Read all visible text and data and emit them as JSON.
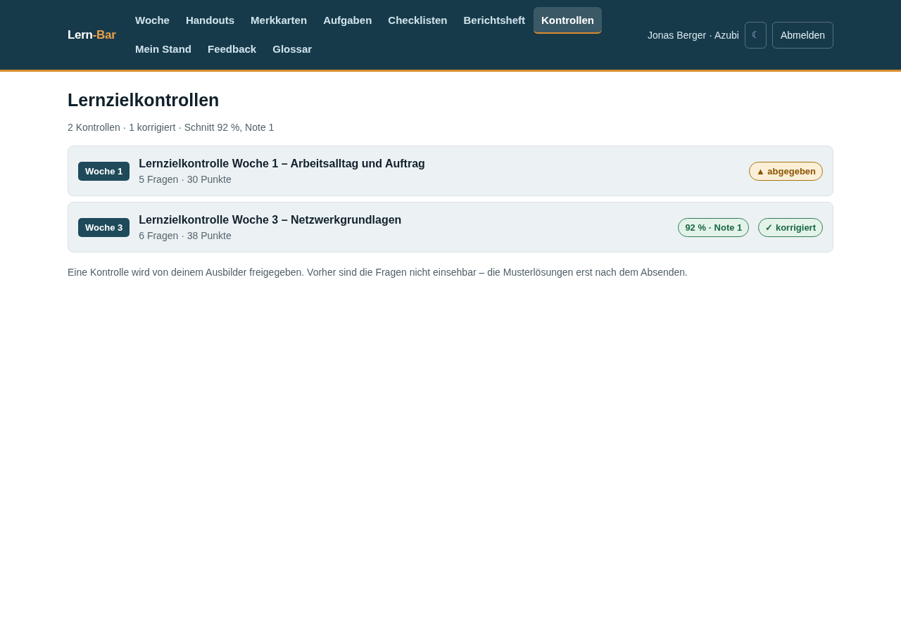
{
  "header": {
    "logo": {
      "text": "Lern",
      "accent": "-Bar"
    },
    "nav": [
      {
        "label": "Woche",
        "selected": false
      },
      {
        "label": "Handouts",
        "selected": false
      },
      {
        "label": "Merkkarten",
        "selected": false
      },
      {
        "label": "Aufgaben",
        "selected": false
      },
      {
        "label": "Checklisten",
        "selected": false
      },
      {
        "label": "Berichtsheft",
        "selected": false
      },
      {
        "label": "Kontrollen",
        "selected": true
      },
      {
        "label": "Mein Stand",
        "selected": false
      },
      {
        "label": "Feedback",
        "selected": false
      },
      {
        "label": "Glossar",
        "selected": false
      }
    ],
    "user": "Jonas Berger · Azubi",
    "theme_button": "☾",
    "logout_button": "Abmelden"
  },
  "page": {
    "title": "Lernzielkontrollen",
    "summary": "2 Kontrollen · 1 korrigiert · Schnitt 92 %, Note 1"
  },
  "controls": [
    {
      "week": "Woche 1",
      "title": "Lernzielkontrolle Woche 1 – Arbeitsalltag und Auftrag",
      "meta": "5 Fragen · 30 Punkte",
      "tags": [
        {
          "kind": "pending",
          "text": "▲ abgegeben"
        }
      ]
    },
    {
      "week": "Woche 3",
      "title": "Lernzielkontrolle Woche 3 – Netzwerkgrundlagen",
      "meta": "6 Fragen · 38 Punkte",
      "tags": [
        {
          "kind": "score",
          "text": "92 % · Note 1"
        },
        {
          "kind": "done",
          "text": "✓ korrigiert"
        }
      ]
    }
  ],
  "footnote": "Eine Kontrolle wird von deinem Ausbilder freigegeben. Vorher sind die Fragen nicht einsehbar – die Musterlösungen erst nach dem Absenden."
}
